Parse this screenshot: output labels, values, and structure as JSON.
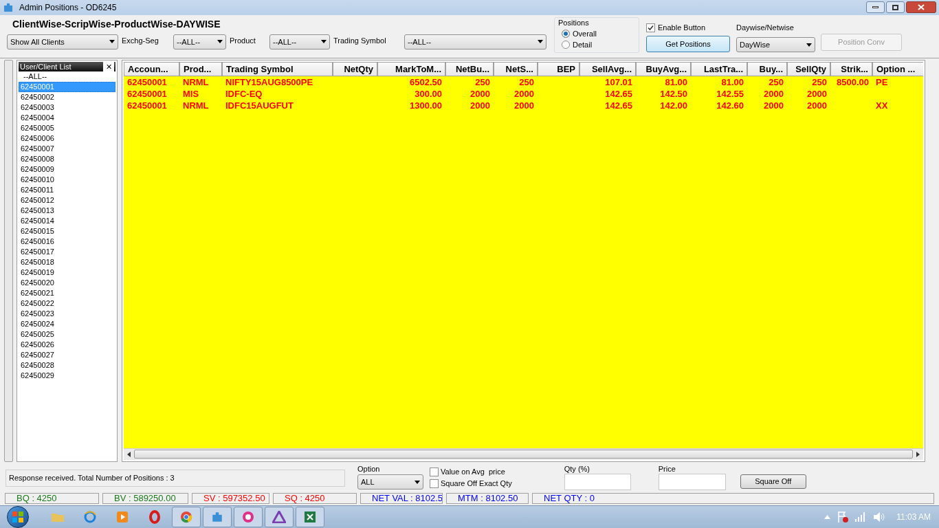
{
  "window": {
    "title": "Admin Positions - OD6245"
  },
  "heading": "ClientWise-ScripWise-ProductWise-DAYWISE",
  "filters": {
    "clients": "Show All Clients",
    "exchg_label": "Exchg-Seg",
    "exchg": "--ALL--",
    "product_label": "Product",
    "product": "--ALL--",
    "symbol_label": "Trading Symbol",
    "symbol": "--ALL--"
  },
  "positions": {
    "label": "Positions",
    "options": [
      {
        "label": "Overall",
        "selected": true
      },
      {
        "label": "Detail",
        "selected": false
      }
    ]
  },
  "enable_button": {
    "label": "Enable Button",
    "checked": true
  },
  "get_positions": "Get Positions",
  "daywise": {
    "label": "Daywise/Netwise",
    "value": "DayWise"
  },
  "position_conv": {
    "label": "Position Conv",
    "disabled": true
  },
  "client_list": {
    "title": "User/Client List",
    "close": "✕",
    "items": [
      {
        "label": "--ALL--",
        "selected": false
      },
      {
        "label": "62450001",
        "selected": true
      },
      {
        "label": "62450002",
        "selected": false
      },
      {
        "label": "62450003",
        "selected": false
      },
      {
        "label": "62450004",
        "selected": false
      },
      {
        "label": "62450005",
        "selected": false
      },
      {
        "label": "62450006",
        "selected": false
      },
      {
        "label": "62450007",
        "selected": false
      },
      {
        "label": "62450008",
        "selected": false
      },
      {
        "label": "62450009",
        "selected": false
      },
      {
        "label": "62450010",
        "selected": false
      },
      {
        "label": "62450011",
        "selected": false
      },
      {
        "label": "62450012",
        "selected": false
      },
      {
        "label": "62450013",
        "selected": false
      },
      {
        "label": "62450014",
        "selected": false
      },
      {
        "label": "62450015",
        "selected": false
      },
      {
        "label": "62450016",
        "selected": false
      },
      {
        "label": "62450017",
        "selected": false
      },
      {
        "label": "62450018",
        "selected": false
      },
      {
        "label": "62450019",
        "selected": false
      },
      {
        "label": "62450020",
        "selected": false
      },
      {
        "label": "62450021",
        "selected": false
      },
      {
        "label": "62450022",
        "selected": false
      },
      {
        "label": "62450023",
        "selected": false
      },
      {
        "label": "62450024",
        "selected": false
      },
      {
        "label": "62450025",
        "selected": false
      },
      {
        "label": "62450026",
        "selected": false
      },
      {
        "label": "62450027",
        "selected": false
      },
      {
        "label": "62450028",
        "selected": false
      },
      {
        "label": "62450029",
        "selected": false
      }
    ]
  },
  "table": {
    "columns": [
      "Accoun...",
      "Prod...",
      "Trading Symbol",
      "NetQty",
      "MarkToM...",
      "NetBu...",
      "NetS...",
      "BEP",
      "SellAvg...",
      "BuyAvg...",
      "LastTra...",
      "Buy...",
      "SellQty",
      "Strik...",
      "Option ..."
    ],
    "rows": [
      [
        "62450001",
        "NRML",
        "NIFTY15AUG8500PE",
        "",
        "6502.50",
        "250",
        "250",
        "",
        "107.01",
        "81.00",
        "81.00",
        "250",
        "250",
        "8500.00",
        "PE"
      ],
      [
        "62450001",
        "MIS",
        "IDFC-EQ",
        "",
        "300.00",
        "2000",
        "2000",
        "",
        "142.65",
        "142.50",
        "142.55",
        "2000",
        "2000",
        "",
        ""
      ],
      [
        "62450001",
        "NRML",
        "IDFC15AUGFUT",
        "",
        "1300.00",
        "2000",
        "2000",
        "",
        "142.65",
        "142.00",
        "142.60",
        "2000",
        "2000",
        "",
        "XX"
      ]
    ]
  },
  "message": "Response received. Total Number of Positions : 3",
  "option": {
    "label": "Option",
    "value": "ALL"
  },
  "checks": [
    {
      "label": "Value on Avg  price",
      "checked": false
    },
    {
      "label": "Square Off Exact Qty",
      "checked": false
    }
  ],
  "qty_label": "Qty (%)",
  "price_label": "Price",
  "square_off": "Square Off",
  "status_bar": [
    {
      "text": "BQ : 4250",
      "color": "#1a7a1a"
    },
    {
      "text": "BV : 589250.00",
      "color": "#1a7a1a"
    },
    {
      "text": "SV : 597352.50",
      "color": "#ff0000"
    },
    {
      "text": "SQ : 4250",
      "color": "#ff0000"
    },
    {
      "text": "NET VAL : 8102.5",
      "color": "#0000ff"
    },
    {
      "text": "MTM : 8102.50",
      "color": "#0000ff"
    },
    {
      "text": "NET QTY : 0",
      "color": "#0000ff"
    }
  ],
  "taskbar": {
    "time": "11:03 AM"
  }
}
